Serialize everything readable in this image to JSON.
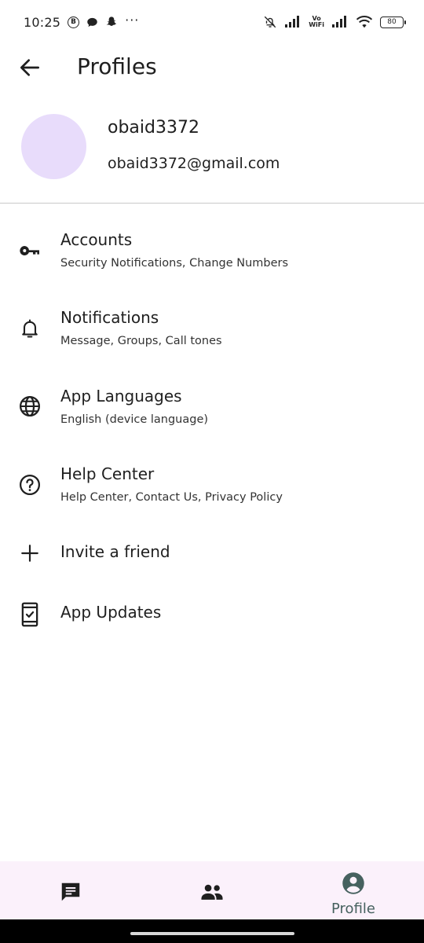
{
  "status_bar": {
    "time": "10:25",
    "b_badge": "B",
    "more": "···",
    "vowifi_top": "Vo",
    "vowifi_bottom": "WiFi",
    "battery": "80"
  },
  "app_bar": {
    "title": "Profiles",
    "back_icon": "arrow-back-icon"
  },
  "profile": {
    "name": "obaid3372",
    "email": "obaid3372@gmail.com",
    "avatar_color": "#e8dcfb"
  },
  "menu": {
    "items": [
      {
        "title": "Accounts",
        "subtitle": "Security Notifications, Change Numbers",
        "icon": "key-icon"
      },
      {
        "title": "Notifications",
        "subtitle": "Message, Groups, Call tones",
        "icon": "bell-icon"
      },
      {
        "title": "App Languages",
        "subtitle": "English (device language)",
        "icon": "globe-icon"
      },
      {
        "title": "Help Center",
        "subtitle": "Help Center, Contact Us, Privacy Policy",
        "icon": "help-circle-icon"
      },
      {
        "title": "Invite a friend",
        "icon": "plus-icon"
      },
      {
        "title": "App Updates",
        "icon": "phone-update-icon"
      }
    ]
  },
  "bottom_nav": {
    "items": [
      {
        "icon": "chat-icon"
      },
      {
        "icon": "people-icon"
      },
      {
        "label": "Profile",
        "icon": "account-circle-icon",
        "active": true
      }
    ],
    "background": "#fbf1fb",
    "active_color": "#46615f"
  }
}
